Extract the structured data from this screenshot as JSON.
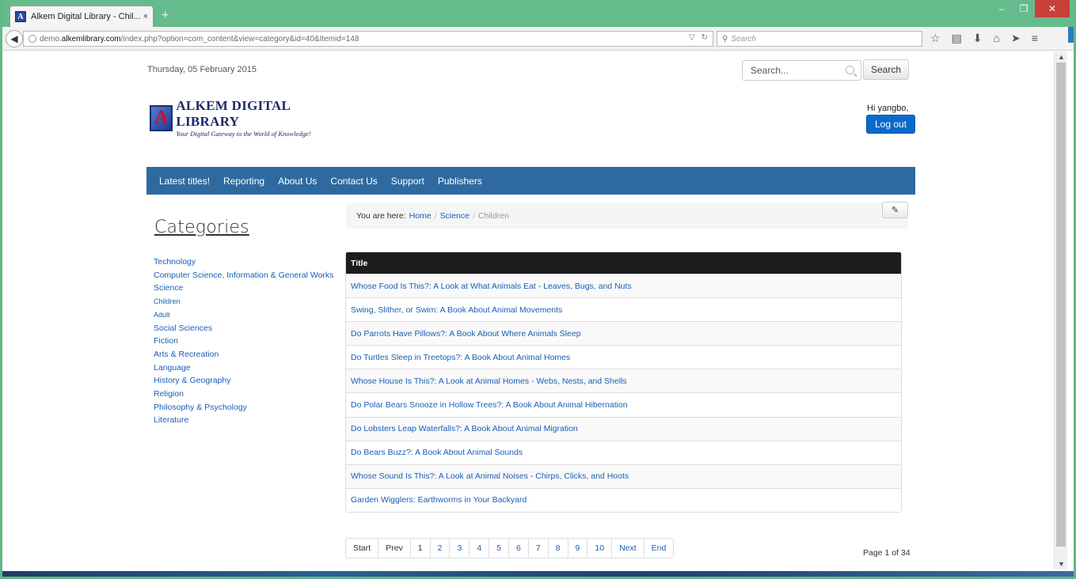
{
  "browser": {
    "tab_title": "Alkem Digital Library - Chil...",
    "tab_close": "×",
    "new_tab": "+",
    "url_prefix": "demo.",
    "url_host": "alkemlibrary.com",
    "url_path": "/index.php?option=com_content&view=category&id=40&Itemid=148",
    "search_placeholder": "Search",
    "controls": {
      "minimize": "–",
      "restore": "❐",
      "close": "✕"
    },
    "icons": [
      "star-icon",
      "reading-list-icon",
      "download-icon",
      "home-icon",
      "send-icon",
      "menu-icon"
    ]
  },
  "header": {
    "date": "Thursday, 05 February 2015",
    "search_placeholder": "Search...",
    "search_button": "Search",
    "logo_title": "ALKEM DIGITAL LIBRARY",
    "logo_tagline": "Your Digital Gateway to the World of Knowledge!",
    "greeting": "Hi yangbo,",
    "logout": "Log out"
  },
  "nav": [
    "Latest titles!",
    "Reporting",
    "About Us",
    "Contact Us",
    "Support",
    "Publishers"
  ],
  "sidebar": {
    "title": "Categories",
    "items": [
      {
        "label": "Technology",
        "small": false
      },
      {
        "label": "Computer Science, Information & General Works",
        "small": false
      },
      {
        "label": "Science",
        "small": false
      },
      {
        "label": "Children",
        "small": true
      },
      {
        "label": "Adult",
        "small": true
      },
      {
        "label": "Social Sciences",
        "small": false
      },
      {
        "label": "Fiction",
        "small": false
      },
      {
        "label": "Arts & Recreation",
        "small": false
      },
      {
        "label": "Language",
        "small": false
      },
      {
        "label": "History & Geography",
        "small": false
      },
      {
        "label": "Religion",
        "small": false
      },
      {
        "label": "Philosophy & Psychology",
        "small": false
      },
      {
        "label": "Literature",
        "small": false
      }
    ]
  },
  "breadcrumb": {
    "prefix": "You are here:",
    "home": "Home",
    "section": "Science",
    "current": "Children",
    "separator": "/",
    "edit_icon": "edit-icon"
  },
  "results": {
    "header": "Title",
    "rows": [
      "Whose Food Is This?: A Look at What Animals Eat - Leaves, Bugs, and Nuts",
      "Swing, Slither, or Swim: A Book About Animal Movements",
      "Do Parrots Have Pillows?: A Book About Where Animals Sleep",
      "Do Turtles Sleep in Treetops?: A Book About Animal Homes",
      "Whose House Is This?: A Look at Animal Homes - Webs, Nests, and Shells",
      "Do Polar Bears Snooze in Hollow Trees?: A Book About Animal Hibernation",
      "Do Lobsters Leap Waterfalls?: A Book About Animal Migration",
      "Do Bears Buzz?: A Book About Animal Sounds",
      "Whose Sound Is This?: A Look at Animal Noises - Chirps, Clicks, and Hoots",
      "Garden Wigglers: Earthworms in Your Backyard"
    ]
  },
  "pagination": {
    "items": [
      {
        "label": "Start",
        "plain": true
      },
      {
        "label": "Prev",
        "plain": true
      },
      {
        "label": "1",
        "plain": true
      },
      {
        "label": "2",
        "plain": false
      },
      {
        "label": "3",
        "plain": false
      },
      {
        "label": "4",
        "plain": false
      },
      {
        "label": "5",
        "plain": false
      },
      {
        "label": "6",
        "plain": false
      },
      {
        "label": "7",
        "plain": false
      },
      {
        "label": "8",
        "plain": false
      },
      {
        "label": "9",
        "plain": false
      },
      {
        "label": "10",
        "plain": false
      },
      {
        "label": "Next",
        "plain": false
      },
      {
        "label": "End",
        "plain": false
      }
    ],
    "page_count": "Page 1 of 34"
  },
  "colors": {
    "nav_bg": "#2e6aa0",
    "link": "#1a5fb4",
    "table_header": "#1c1c1c",
    "logout_bg": "#0a6ac9",
    "titlebar": "#65bb8c"
  }
}
